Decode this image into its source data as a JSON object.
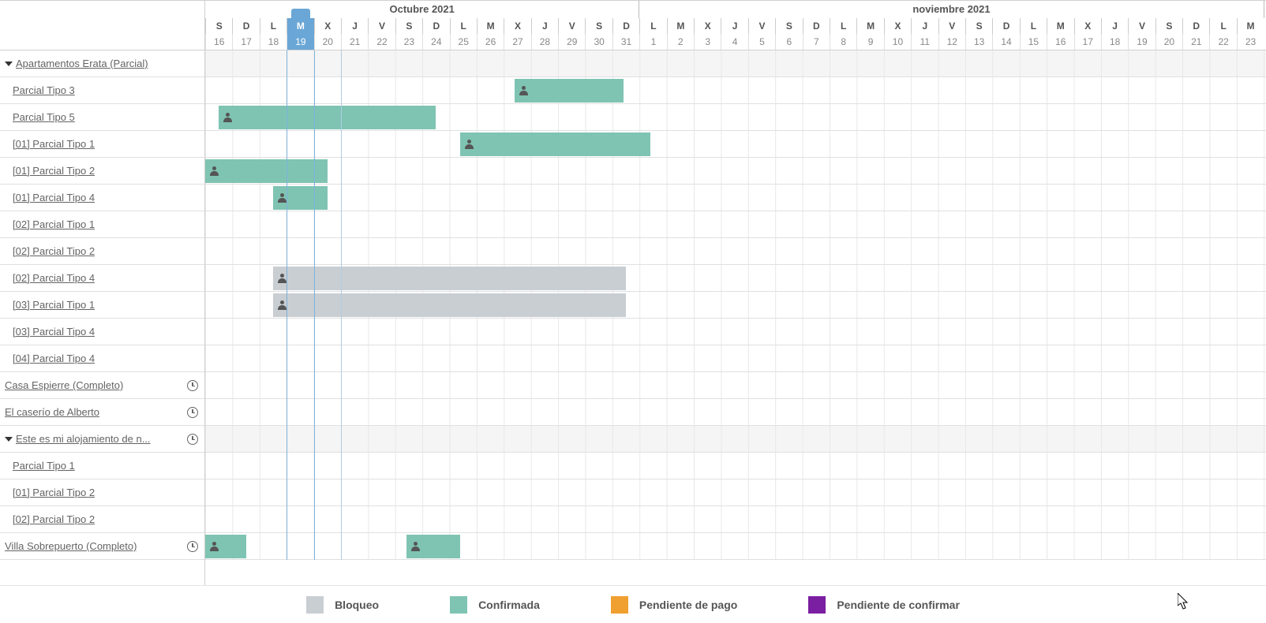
{
  "months": [
    {
      "label": "Octubre 2021",
      "span": 16
    },
    {
      "label": "noviembre 2021",
      "span": 23
    }
  ],
  "columns": [
    {
      "dow": "S",
      "num": "16"
    },
    {
      "dow": "D",
      "num": "17"
    },
    {
      "dow": "L",
      "num": "18"
    },
    {
      "dow": "M",
      "num": "19",
      "today": true
    },
    {
      "dow": "X",
      "num": "20"
    },
    {
      "dow": "J",
      "num": "21"
    },
    {
      "dow": "V",
      "num": "22"
    },
    {
      "dow": "S",
      "num": "23"
    },
    {
      "dow": "D",
      "num": "24"
    },
    {
      "dow": "L",
      "num": "25"
    },
    {
      "dow": "M",
      "num": "26"
    },
    {
      "dow": "X",
      "num": "27"
    },
    {
      "dow": "J",
      "num": "28"
    },
    {
      "dow": "V",
      "num": "29"
    },
    {
      "dow": "S",
      "num": "30"
    },
    {
      "dow": "D",
      "num": "31"
    },
    {
      "dow": "L",
      "num": "1"
    },
    {
      "dow": "M",
      "num": "2"
    },
    {
      "dow": "X",
      "num": "3"
    },
    {
      "dow": "J",
      "num": "4"
    },
    {
      "dow": "V",
      "num": "5"
    },
    {
      "dow": "S",
      "num": "6"
    },
    {
      "dow": "D",
      "num": "7"
    },
    {
      "dow": "L",
      "num": "8"
    },
    {
      "dow": "M",
      "num": "9"
    },
    {
      "dow": "X",
      "num": "10"
    },
    {
      "dow": "J",
      "num": "11"
    },
    {
      "dow": "V",
      "num": "12"
    },
    {
      "dow": "S",
      "num": "13"
    },
    {
      "dow": "D",
      "num": "14"
    },
    {
      "dow": "L",
      "num": "15"
    },
    {
      "dow": "M",
      "num": "16"
    },
    {
      "dow": "X",
      "num": "17"
    },
    {
      "dow": "J",
      "num": "18"
    },
    {
      "dow": "V",
      "num": "19"
    },
    {
      "dow": "S",
      "num": "20"
    },
    {
      "dow": "D",
      "num": "21"
    },
    {
      "dow": "L",
      "num": "22"
    },
    {
      "dow": "M",
      "num": "23"
    }
  ],
  "rows": [
    {
      "label": "Apartamentos Erata (Parcial)",
      "type": "group",
      "caret": true
    },
    {
      "label": "Parcial Tipo 3",
      "type": "child"
    },
    {
      "label": "Parcial Tipo 5",
      "type": "child"
    },
    {
      "label": "[01] Parcial Tipo 1",
      "type": "child"
    },
    {
      "label": "[01] Parcial Tipo 2",
      "type": "child"
    },
    {
      "label": "[01] Parcial Tipo 4",
      "type": "child"
    },
    {
      "label": "[02] Parcial Tipo 1",
      "type": "child"
    },
    {
      "label": "[02] Parcial Tipo 2",
      "type": "child"
    },
    {
      "label": "[02] Parcial Tipo 4",
      "type": "child"
    },
    {
      "label": "[03] Parcial Tipo 1",
      "type": "child"
    },
    {
      "label": "[03] Parcial Tipo 4",
      "type": "child"
    },
    {
      "label": "[04] Parcial Tipo 4",
      "type": "child"
    },
    {
      "label": "Casa Espierre (Completo)",
      "type": "top",
      "clock": true
    },
    {
      "label": "El caserío de Alberto",
      "type": "top",
      "clock": true
    },
    {
      "label": "Este es mi alojamiento de n...",
      "type": "group",
      "caret": true,
      "clock": true
    },
    {
      "label": "Parcial Tipo 1",
      "type": "child"
    },
    {
      "label": "[01] Parcial Tipo 2",
      "type": "child"
    },
    {
      "label": "[02] Parcial Tipo 2",
      "type": "child"
    },
    {
      "label": "Villa Sobrepuerto (Completo)",
      "type": "top",
      "clock": true
    }
  ],
  "bookings": [
    {
      "row": 1,
      "startCol": 11.4,
      "span": 4,
      "status": "confirmed"
    },
    {
      "row": 2,
      "startCol": 0.5,
      "span": 8,
      "status": "confirmed"
    },
    {
      "row": 3,
      "startCol": 9.4,
      "span": 7,
      "status": "confirmed"
    },
    {
      "row": 4,
      "startCol": 0,
      "span": 4.5,
      "status": "confirmed"
    },
    {
      "row": 5,
      "startCol": 2.5,
      "span": 2,
      "status": "confirmed"
    },
    {
      "row": 8,
      "startCol": 2.5,
      "span": 13,
      "status": "blocked"
    },
    {
      "row": 9,
      "startCol": 2.5,
      "span": 13,
      "status": "blocked"
    },
    {
      "row": 18,
      "startCol": 0,
      "span": 1.5,
      "status": "confirmed"
    },
    {
      "row": 18,
      "startCol": 7.4,
      "span": 2,
      "status": "confirmed"
    }
  ],
  "legend": [
    {
      "label": "Bloqueo",
      "color": "#c9ced3"
    },
    {
      "label": "Confirmada",
      "color": "#7fc4b2"
    },
    {
      "label": "Pendiente de pago",
      "color": "#f0a030"
    },
    {
      "label": "Pendiente de confirmar",
      "color": "#7a1fa2"
    }
  ],
  "colors": {
    "confirmed": "#7fc4b2",
    "blocked": "#c9ced3",
    "pending_payment": "#f0a030",
    "pending_confirm": "#7a1fa2",
    "today": "#6aa7d6"
  },
  "cellWidth": 34.4
}
